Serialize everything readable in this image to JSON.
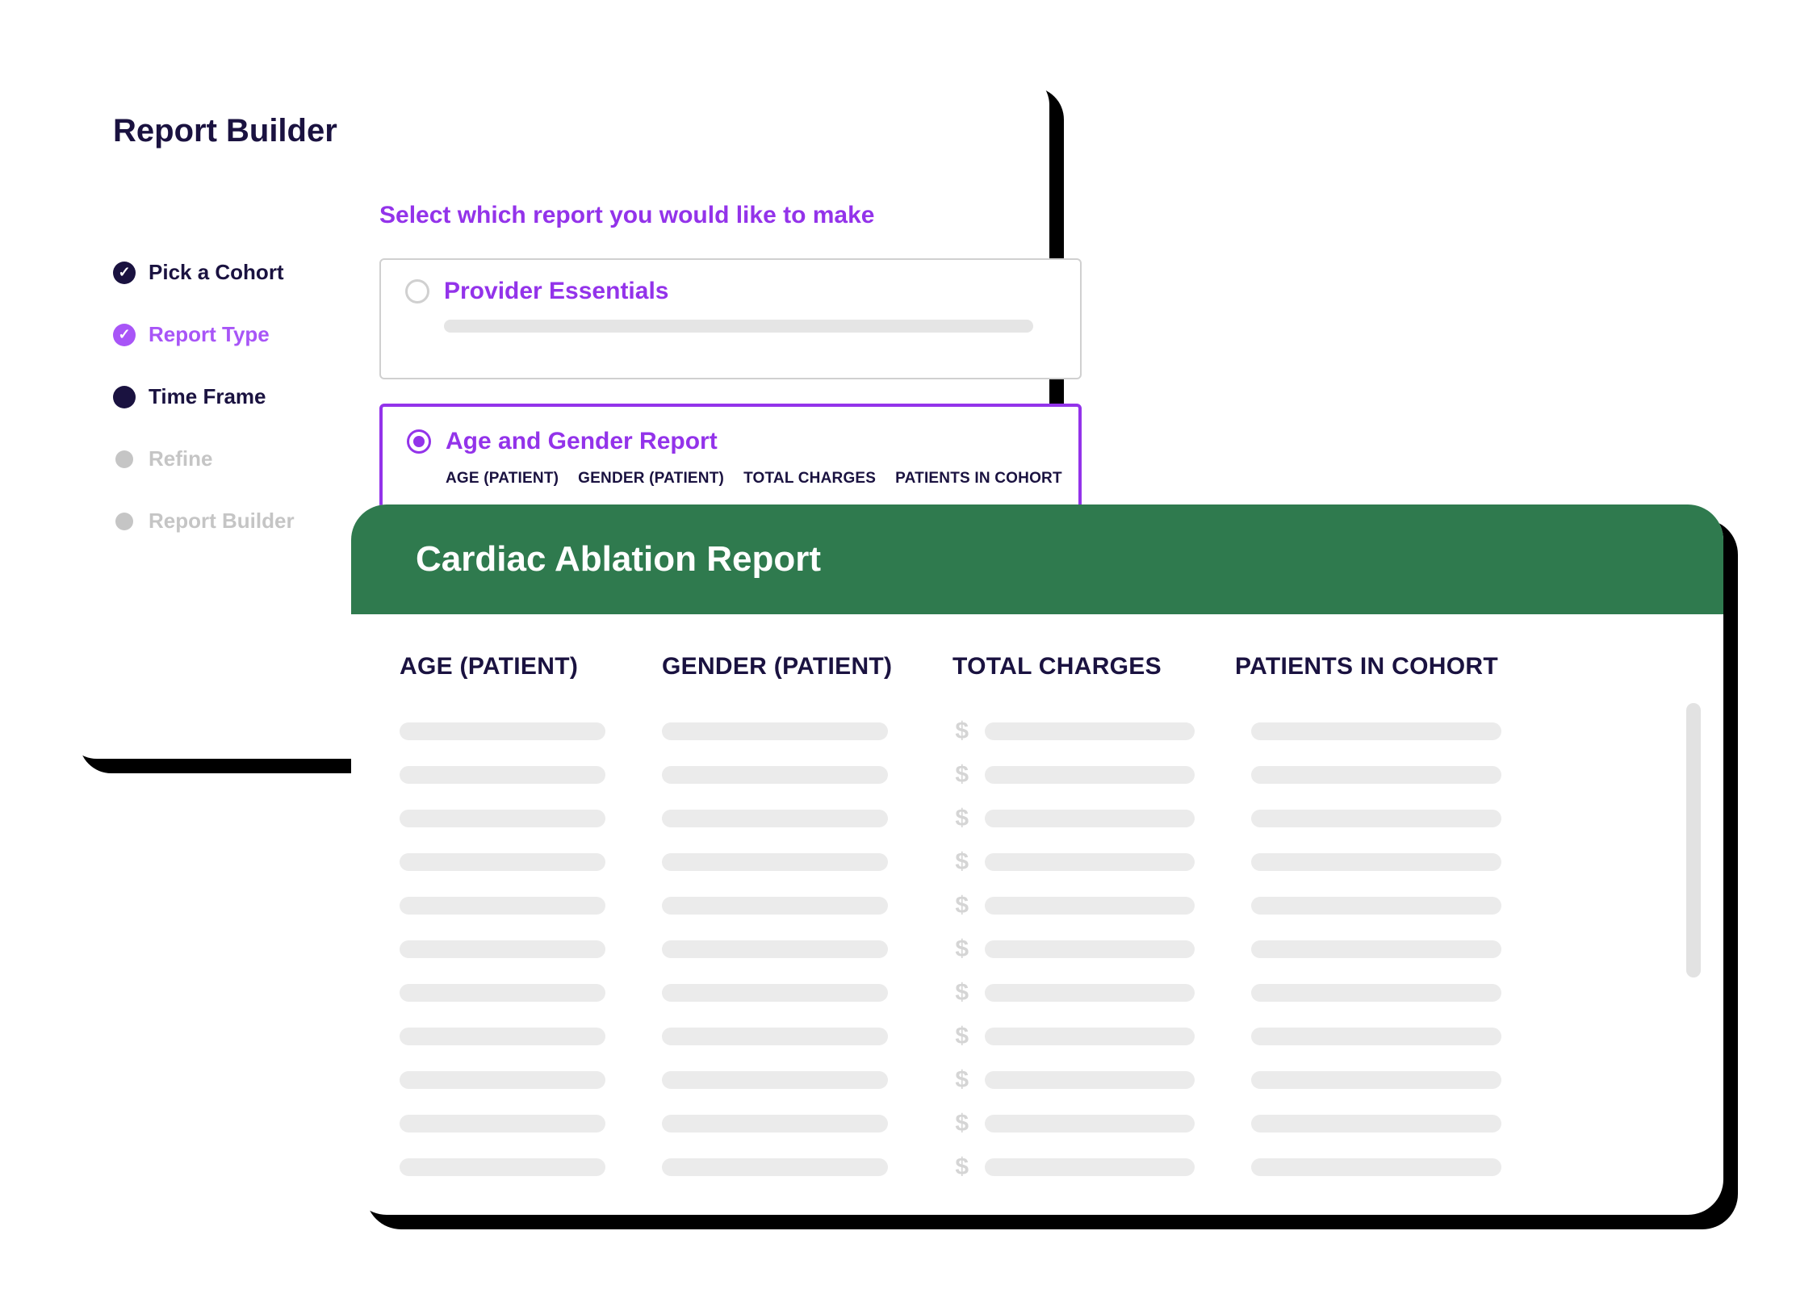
{
  "builder": {
    "title": "Report Builder",
    "subtitle": "Select which report you would like to make",
    "steps": [
      {
        "label": "Pick a Cohort",
        "state": "done-dark"
      },
      {
        "label": "Report Type",
        "state": "done-purple"
      },
      {
        "label": "Time Frame",
        "state": "current"
      },
      {
        "label": "Refine",
        "state": "pending"
      },
      {
        "label": "Report Builder",
        "state": "pending"
      }
    ],
    "options": [
      {
        "title": "Provider Essentials",
        "selected": false
      },
      {
        "title": "Age and Gender Report",
        "selected": true,
        "columns": [
          "AGE (PATIENT)",
          "GENDER (PATIENT)",
          "TOTAL CHARGES",
          "PATIENTS IN COHORT"
        ]
      }
    ]
  },
  "report": {
    "title": "Cardiac Ablation Report",
    "columns": [
      "AGE (PATIENT)",
      "GENDER (PATIENT)",
      "TOTAL CHARGES",
      "PATIENTS IN COHORT"
    ],
    "currency_symbol": "$",
    "row_count": 11
  },
  "colors": {
    "accent_purple": "#9333ea",
    "dark_navy": "#1a1240",
    "header_green": "#2f7a4e"
  }
}
